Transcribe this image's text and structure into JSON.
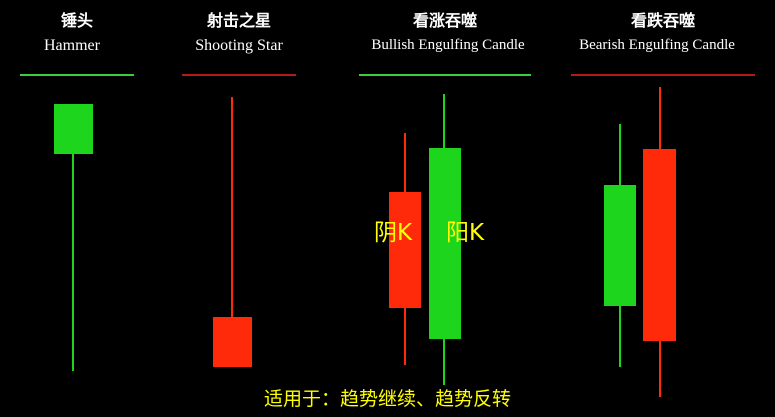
{
  "colors": {
    "background": "#000000",
    "bullish": "#1ed51e",
    "bearish": "#ff2a0a",
    "bullish_divider": "#3ccc3c",
    "bearish_divider": "#b31a1a",
    "label": "#ffff00",
    "title": "#ffffff"
  },
  "patterns": [
    {
      "cn": "锤头",
      "en": "Hammer",
      "divider_color": "bullish"
    },
    {
      "cn": "射击之星",
      "en": "Shooting Star",
      "divider_color": "bearish"
    },
    {
      "cn": "看涨吞噬",
      "en": "Bullish Engulfing Candle",
      "divider_color": "bullish"
    },
    {
      "cn": "看跌吞噬",
      "en": "Bearish Engulfing Candle",
      "divider_color": "bearish"
    }
  ],
  "labels": {
    "yin": "阴K",
    "yang": "阳K"
  },
  "footer": "适用于：趋势继续、趋势反转"
}
